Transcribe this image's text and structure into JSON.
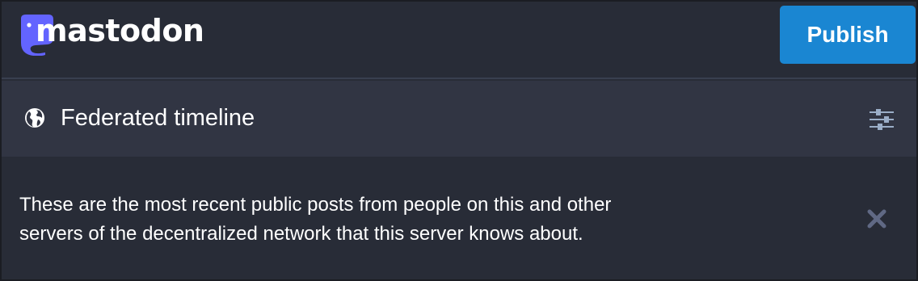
{
  "header": {
    "logo_text": "mastodon",
    "publish_label": "Publish"
  },
  "column": {
    "icon": "globe-icon",
    "title": "Federated timeline",
    "settings_icon": "sliders-icon"
  },
  "explainer": {
    "line1": "These are the most recent public posts from people on this and other",
    "line2": "servers of the decentralized network that this server knows about.",
    "dismiss_icon": "close-icon"
  },
  "colors": {
    "background": "#282c37",
    "column_header": "#313543",
    "accent": "#1a86d2",
    "logo": "#6364ff"
  }
}
